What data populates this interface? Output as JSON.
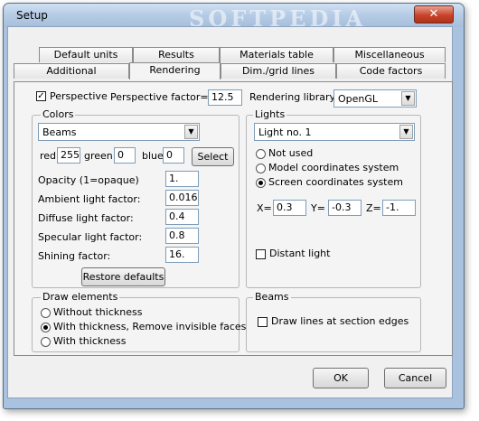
{
  "window": {
    "title": "Setup",
    "watermark": "SOFTPEDIA",
    "close_glyph": "✕"
  },
  "tabs": {
    "row_top": [
      "Default units",
      "Results",
      "Materials table",
      "Miscellaneous"
    ],
    "row_bottom": [
      "Additional",
      "Rendering",
      "Dim./grid lines",
      "Code factors"
    ],
    "active": "Rendering"
  },
  "perspective": {
    "checkbox_label": "Perspective",
    "checked": true,
    "factor_label": "Perspective factor=",
    "factor_value": "12.5",
    "library_label": "Rendering library:",
    "library_value": "OpenGL"
  },
  "colors": {
    "title": "Colors",
    "object_value": "Beams",
    "red_label": "red",
    "red_value": "255",
    "green_label": "green",
    "green_value": "0",
    "blue_label": "blue",
    "blue_value": "0",
    "select_label": "Select",
    "opacity_label": "Opacity (1=opaque)",
    "opacity_value": "1.",
    "ambient_label": "Ambient light factor:",
    "ambient_value": "0.016",
    "diffuse_label": "Diffuse light factor:",
    "diffuse_value": "0.4",
    "specular_label": "Specular light factor:",
    "specular_value": "0.8",
    "shining_label": "Shining factor:",
    "shining_value": "16.",
    "restore_label": "Restore defaults"
  },
  "lights": {
    "title": "Lights",
    "light_value": "Light no. 1",
    "options": [
      "Not used",
      "Model coordinates system",
      "Screen coordinates system"
    ],
    "selected": 2,
    "x_label": "X=",
    "x_value": "0.3",
    "y_label": "Y=",
    "y_value": "-0.3",
    "z_label": "Z=",
    "z_value": "-1.",
    "distant_label": "Distant light",
    "distant_checked": false
  },
  "draw": {
    "title": "Draw elements",
    "options": [
      "Without thickness",
      "With thickness, Remove invisible faces",
      "With thickness"
    ],
    "selected": 1
  },
  "beams": {
    "title": "Beams",
    "edges_label": "Draw lines at section edges",
    "edges_checked": false
  },
  "footer": {
    "ok_label": "OK",
    "cancel_label": "Cancel"
  }
}
